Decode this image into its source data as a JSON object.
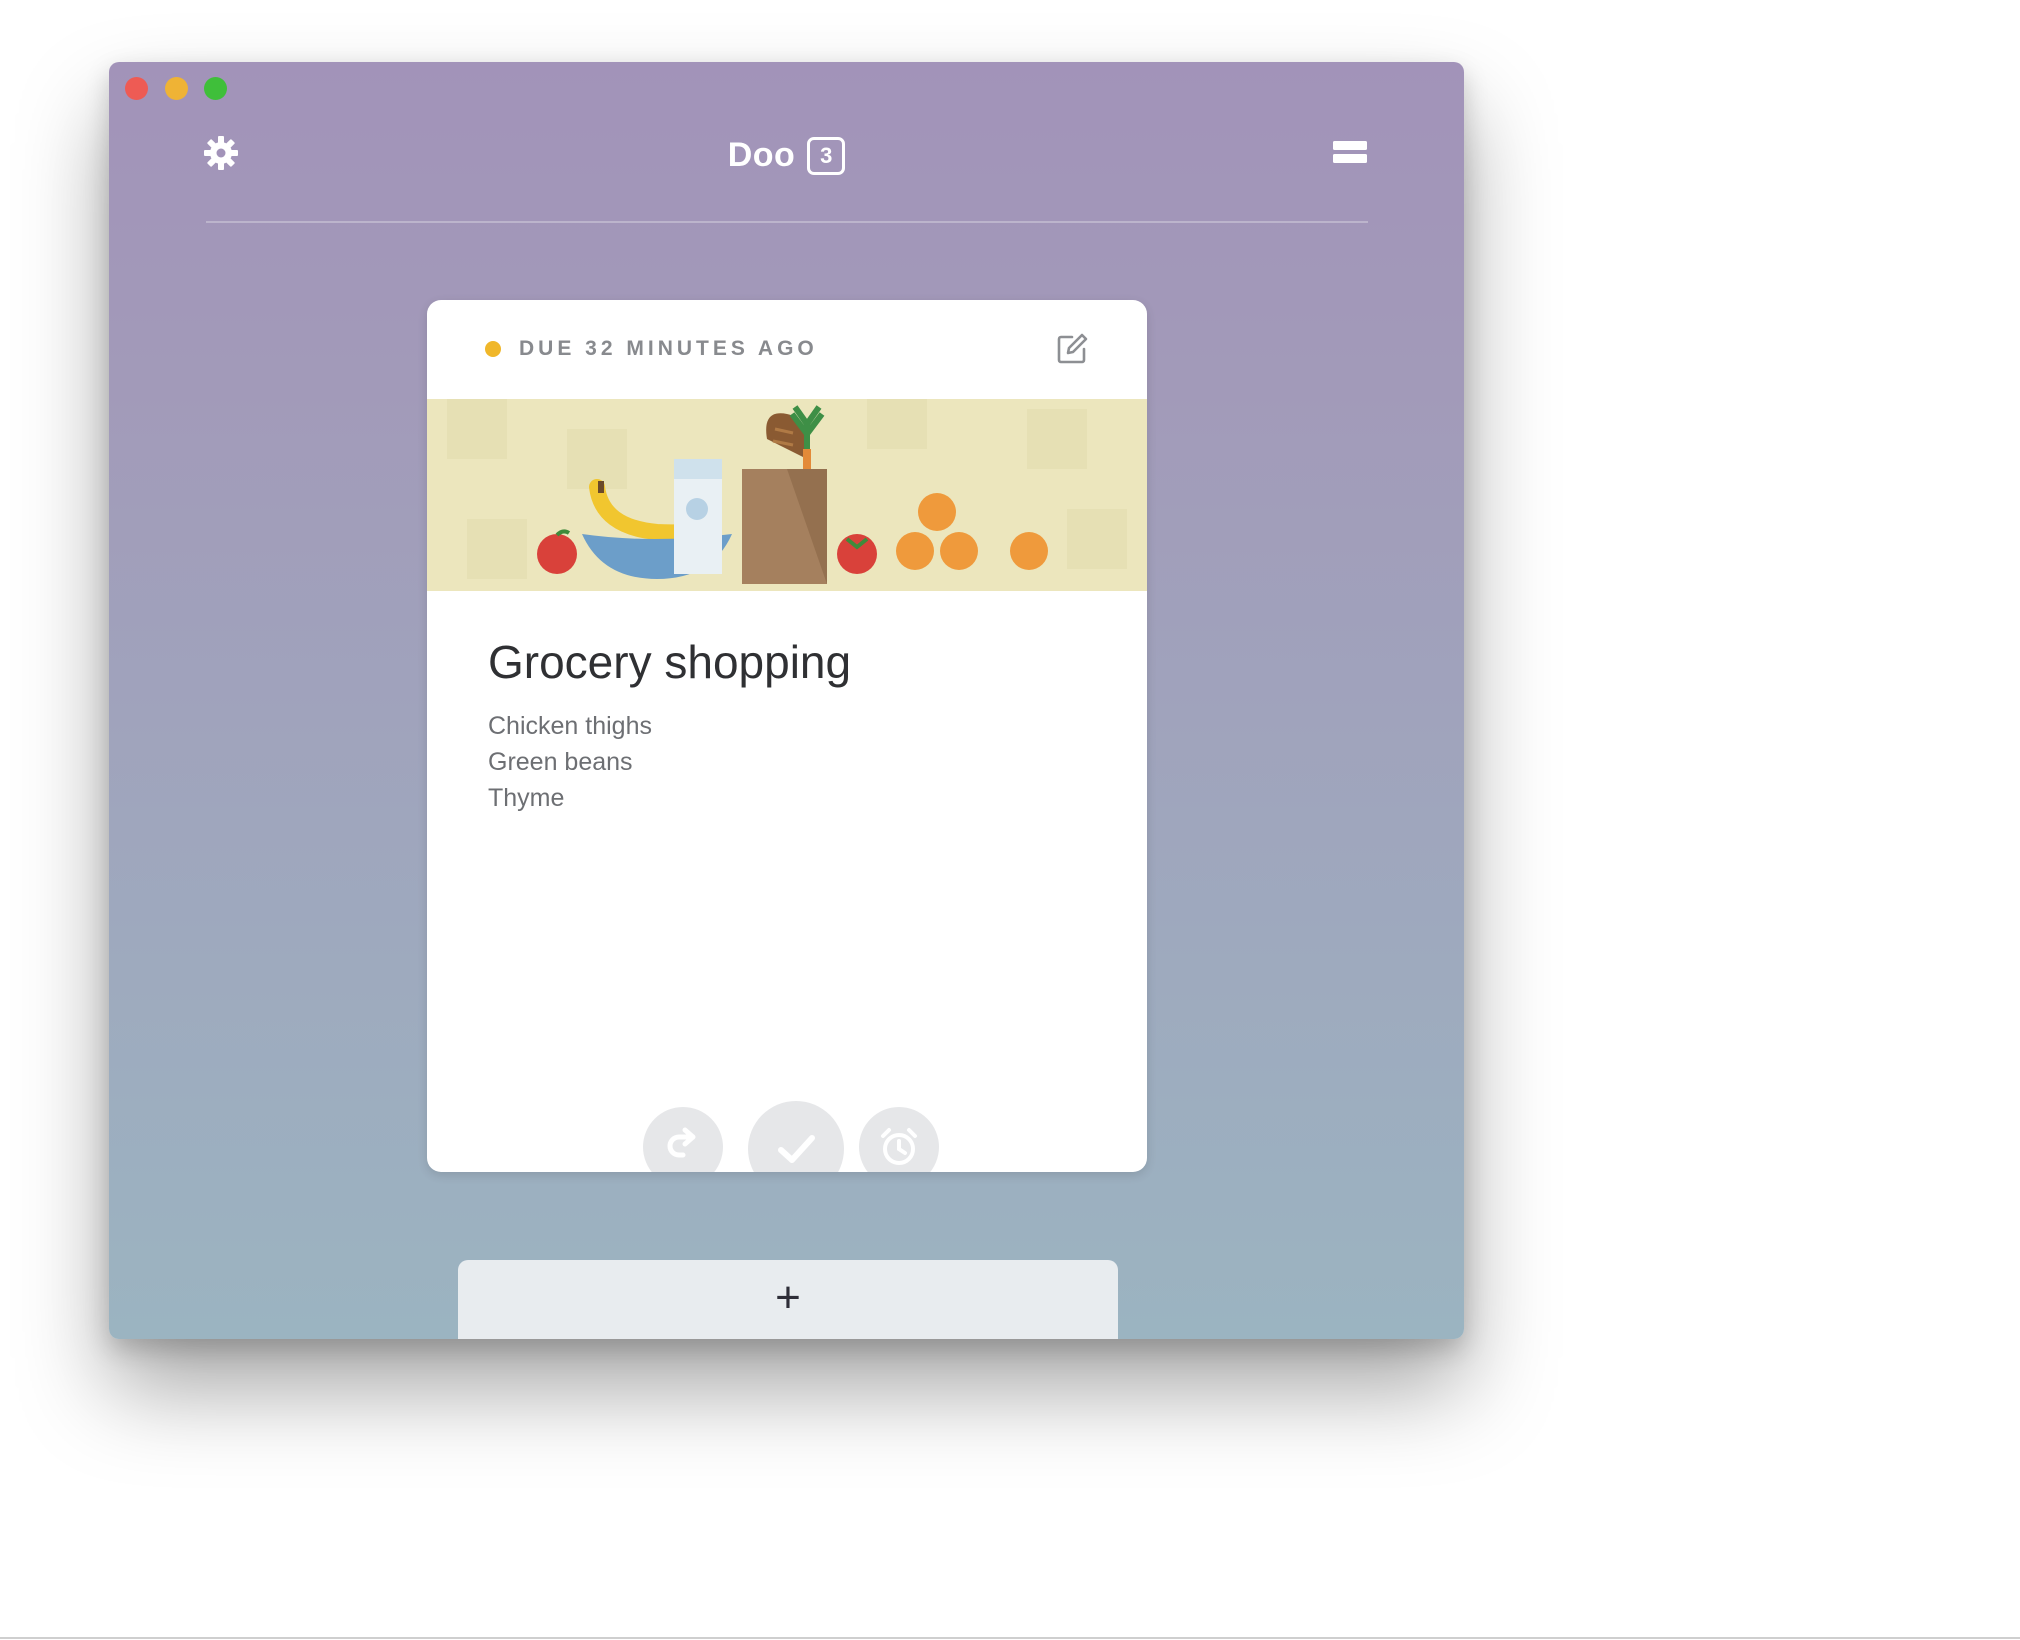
{
  "app": {
    "title": "Doo",
    "count_badge": "3",
    "accent_gradient": [
      "#a293b9",
      "#9bb4c1"
    ]
  },
  "window_controls": {
    "close_color": "#ee5b54",
    "minimize_color": "#efb335",
    "zoom_color": "#3fbf3a"
  },
  "toolbar": {
    "settings_icon": "gear-icon",
    "menu_icon": "list-menu-icon"
  },
  "task": {
    "status_text": "DUE 32 MINUTES AGO",
    "status_color": "#f0b72a",
    "edit_icon": "edit-icon",
    "illustration": "grocery-illustration",
    "title": "Grocery shopping",
    "notes": [
      "Chicken thighs",
      "Green beans",
      "Thyme"
    ],
    "actions": {
      "left_icon": "redo-arrow-icon",
      "center_icon": "checkmark-icon",
      "right_icon": "alarm-clock-icon"
    }
  },
  "add_button": {
    "label": "+"
  }
}
